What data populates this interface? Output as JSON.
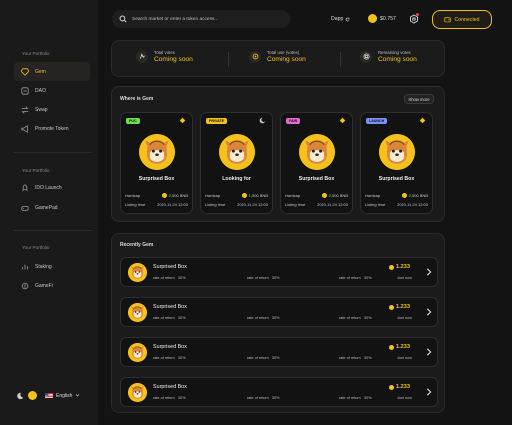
{
  "sidebar": {
    "sections": [
      {
        "heading": "Your Portfolio",
        "items": [
          {
            "label": "Gem",
            "icon": "gem-icon",
            "active": true
          },
          {
            "label": "DAO",
            "icon": "dao-icon",
            "active": false
          },
          {
            "label": "Swap",
            "icon": "swap-icon",
            "active": false
          },
          {
            "label": "Promote Token",
            "icon": "megaphone-icon",
            "active": false
          }
        ]
      },
      {
        "heading": "Your Portfolio",
        "items": [
          {
            "label": "IDO Launch",
            "icon": "rocket-icon",
            "active": false
          },
          {
            "label": "GamePad",
            "icon": "gamepad-icon",
            "active": false
          }
        ]
      },
      {
        "heading": "Your Portfolio",
        "items": [
          {
            "label": "Staking",
            "icon": "staking-icon",
            "active": false
          },
          {
            "label": "GameFi",
            "icon": "gamefi-icon",
            "active": false
          }
        ]
      }
    ],
    "language": "English"
  },
  "header": {
    "search_placeholder": "Search market or enter a token access...",
    "dapp_label": "Dapp",
    "balance": "$0.757",
    "connect_label": "Connected"
  },
  "stats": [
    {
      "label": "Total votes",
      "value": "Coming soon",
      "icon": "vote-icon"
    },
    {
      "label": "Total use (votes)",
      "value": "Coming soon",
      "icon": "user-icon"
    },
    {
      "label": "Remaining votes",
      "value": "Coming soon",
      "icon": "target-icon"
    }
  ],
  "where_is_gem": {
    "title": "Where is Gem",
    "show_more": "Show more",
    "cards": [
      {
        "badge": "PUC",
        "badge_color": "#6ee04a",
        "chain": "bnb-icon",
        "name": "Surprised Box",
        "hardcap_label": "Hardcap",
        "hardcap": "2,500 BNB",
        "listing_label": "Listing time",
        "listing": "2021.11.24 12:00"
      },
      {
        "badge": "PRIVATE",
        "badge_color": "#f4c21b",
        "chain": "moon-icon",
        "name": "Looking for",
        "hardcap_label": "Hardcap",
        "hardcap": "1,500 BNB",
        "listing_label": "Listing time",
        "listing": "2021.11.24 12:00"
      },
      {
        "badge": "FAIR",
        "badge_color": "#e76ad0",
        "chain": "bnb-icon",
        "name": "Surprised Box",
        "hardcap_label": "Hardcap",
        "hardcap": "2,500 BNB",
        "listing_label": "Listing time",
        "listing": "2021.11.24 12:00"
      },
      {
        "badge": "LAUNCH",
        "badge_color": "#7a93f5",
        "chain": "bnb-icon",
        "name": "Surprised Box",
        "hardcap_label": "Hardcap",
        "hardcap": "2,500 BNB",
        "listing_label": "Listing time",
        "listing": "2021.11.24 12:00"
      }
    ]
  },
  "recently_gem": {
    "title": "Recently Gem",
    "items": [
      {
        "name": "Surprised Box",
        "r1_label": "rate of return",
        "r1": "30%",
        "r2_label": "rate of return",
        "r2": "30%",
        "r3_label": "rate of return",
        "r3": "30%",
        "value": "1.233",
        "time": "Just now"
      },
      {
        "name": "Surprised Box",
        "r1_label": "rate of return",
        "r1": "30%",
        "r2_label": "rate of return",
        "r2": "30%",
        "r3_label": "rate of return",
        "r3": "30%",
        "value": "1.233",
        "time": "Just now"
      },
      {
        "name": "Surprised Box",
        "r1_label": "rate of return",
        "r1": "30%",
        "r2_label": "rate of return",
        "r2": "30%",
        "r3_label": "rate of return",
        "r3": "30%",
        "value": "1.233",
        "time": "Just now"
      },
      {
        "name": "Surprised Box",
        "r1_label": "rate of return",
        "r1": "30%",
        "r2_label": "rate of return",
        "r2": "30%",
        "r3_label": "rate of return",
        "r3": "30%",
        "value": "1.233",
        "time": "Just now"
      }
    ]
  },
  "colors": {
    "accent": "#f4c21b",
    "background": "#131313",
    "card": "#1b1b1b"
  }
}
